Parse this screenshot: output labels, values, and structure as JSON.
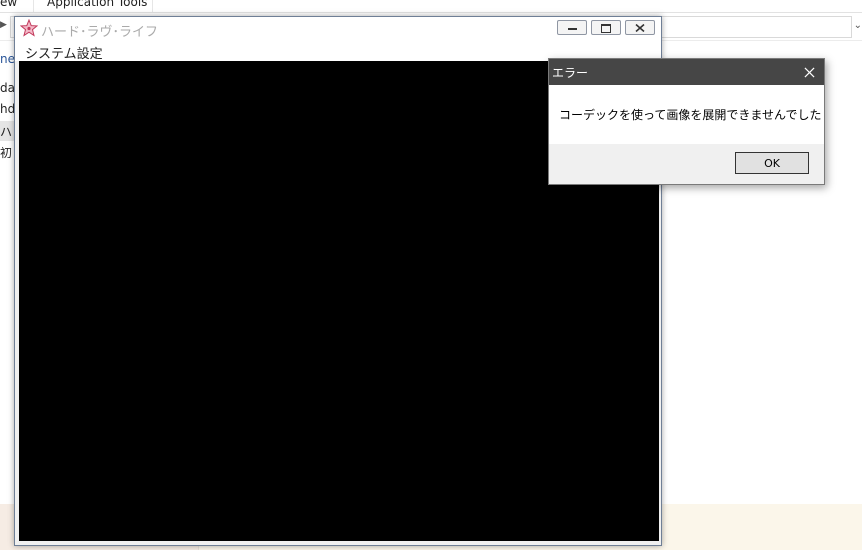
{
  "explorer": {
    "ribbon_tabs": [
      "ew",
      "Application Tools"
    ],
    "nav_fragments": [
      "ne",
      "da",
      "hd",
      "ハ",
      "初"
    ]
  },
  "app_window": {
    "title": "ハード･ラヴ･ライフ",
    "menu": [
      "システム設定"
    ],
    "icon": "star-icon",
    "canvas_color": "#000000"
  },
  "error_dialog": {
    "title": "エラー",
    "message": "コーデックを使って画像を展開できませんでした",
    "ok_label": "OK",
    "titlebar_color": "#464646"
  }
}
